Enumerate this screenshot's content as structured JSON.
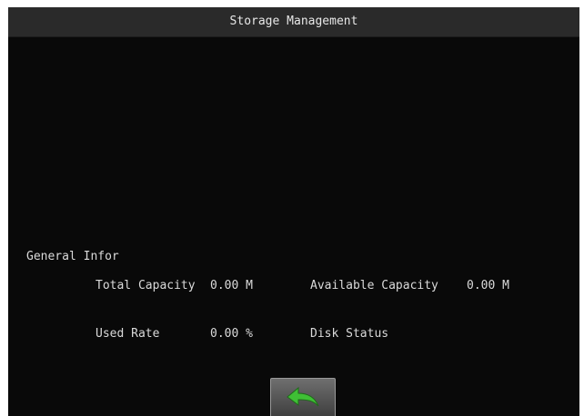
{
  "window": {
    "title": "Storage Management"
  },
  "general": {
    "heading": "General Infor",
    "total_capacity": {
      "label": "Total Capacity",
      "value": "0.00 M"
    },
    "available_capacity": {
      "label": "Available Capacity",
      "value": "0.00 M"
    },
    "used_rate": {
      "label": "Used Rate",
      "value": "0.00 %"
    },
    "disk_status": {
      "label": "Disk Status",
      "value": ""
    }
  },
  "controls": {
    "back_icon": "back-arrow-icon"
  },
  "colors": {
    "background": "#090909",
    "titlebar": "#2a2a2a",
    "text": "#dadada",
    "back_arrow": "#3fbf35"
  }
}
